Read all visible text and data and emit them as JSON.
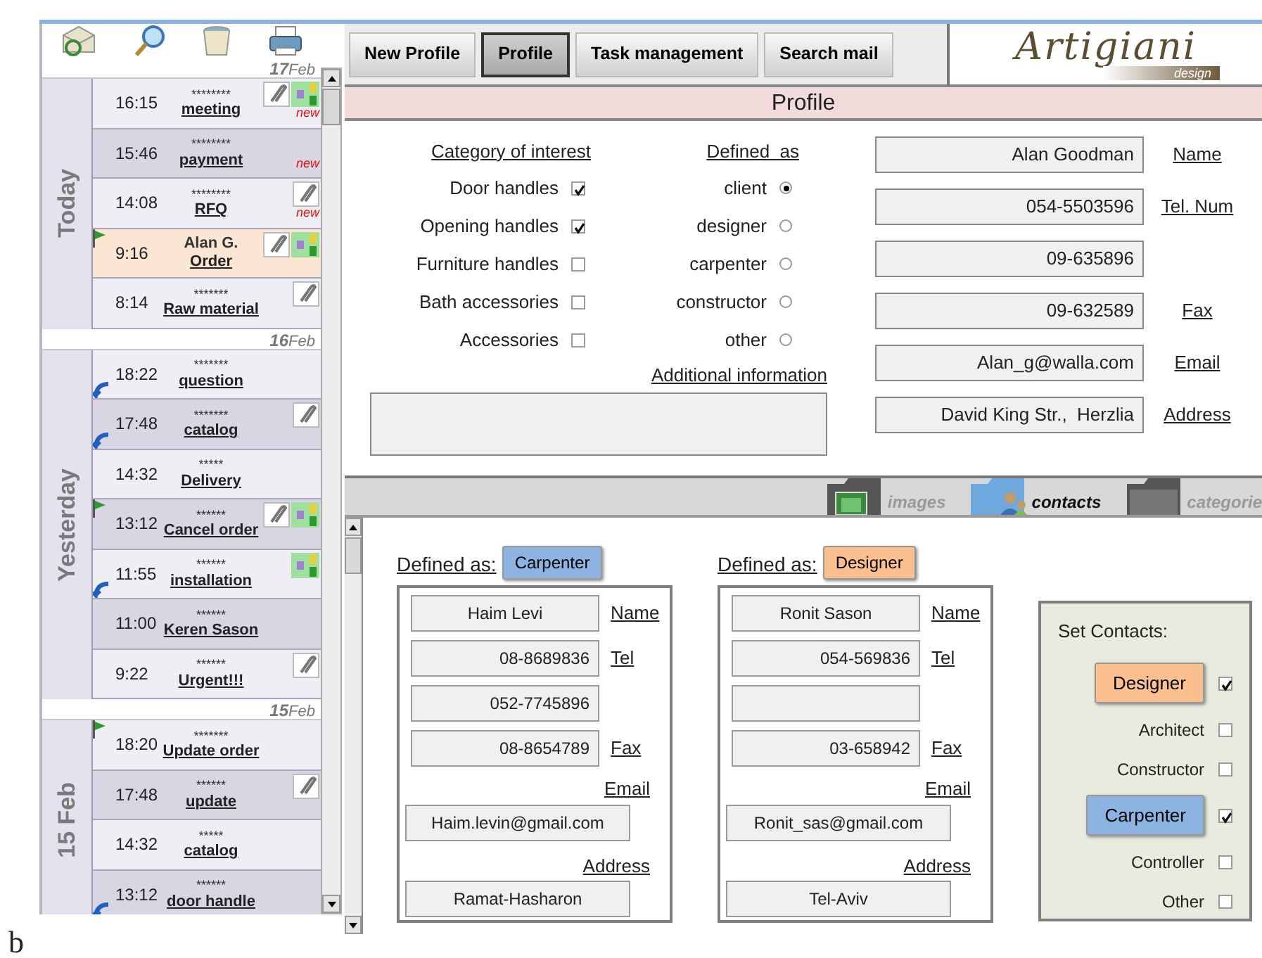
{
  "sidebar": {
    "days": [
      {
        "date_day": "17",
        "date_month": "Feb",
        "label": "Today",
        "messages": [
          {
            "time": "16:15",
            "sender": "********",
            "subject": "meeting",
            "attachment": true,
            "tags": true,
            "badge": "new",
            "flag": false,
            "reply": false,
            "selected": false
          },
          {
            "time": "15:46",
            "sender": "********",
            "subject": "payment",
            "attachment": false,
            "tags": false,
            "badge": "new",
            "flag": false,
            "reply": false,
            "selected": false
          },
          {
            "time": "14:08",
            "sender": "********",
            "subject": "RFQ",
            "attachment": true,
            "tags": false,
            "badge": "new",
            "flag": false,
            "reply": false,
            "selected": false
          },
          {
            "time": "9:16",
            "sender": "Alan G.",
            "subject": "Order",
            "attachment": true,
            "tags": true,
            "flag": true,
            "reply": false,
            "selected": true
          },
          {
            "time": "8:14",
            "sender": "*******",
            "subject": "Raw material",
            "attachment": true,
            "tags": false,
            "flag": false,
            "reply": false,
            "selected": false
          }
        ]
      },
      {
        "date_day": "16",
        "date_month": "Feb",
        "label": "Yesterday",
        "messages": [
          {
            "time": "18:22",
            "sender": "*******",
            "subject": "question",
            "attachment": false,
            "tags": false,
            "flag": false,
            "reply": true,
            "selected": false
          },
          {
            "time": "17:48",
            "sender": "*******",
            "subject": "catalog",
            "attachment": true,
            "tags": false,
            "flag": false,
            "reply": true,
            "selected": false
          },
          {
            "time": "14:32",
            "sender": "*****",
            "subject": "Delivery",
            "attachment": false,
            "tags": false,
            "flag": false,
            "reply": false,
            "selected": false
          },
          {
            "time": "13:12",
            "sender": "******",
            "subject": "Cancel order",
            "attachment": true,
            "tags": true,
            "flag": true,
            "reply": false,
            "selected": false
          },
          {
            "time": "11:55",
            "sender": "******",
            "subject": "installation",
            "attachment": false,
            "tags": true,
            "flag": false,
            "reply": true,
            "selected": false
          },
          {
            "time": "11:00",
            "sender": "******",
            "subject": "Keren Sason",
            "attachment": false,
            "tags": false,
            "flag": false,
            "reply": false,
            "selected": false
          },
          {
            "time": "9:22",
            "sender": "******",
            "subject": "Urgent!!!",
            "attachment": true,
            "tags": false,
            "flag": false,
            "reply": false,
            "selected": false
          }
        ]
      },
      {
        "date_day": "15",
        "date_month": "Feb",
        "label": "15 Feb",
        "messages": [
          {
            "time": "18:20",
            "sender": "*******",
            "subject": "Update order",
            "attachment": false,
            "tags": false,
            "flag": true,
            "reply": false,
            "selected": false
          },
          {
            "time": "17:48",
            "sender": "******",
            "subject": "update",
            "attachment": true,
            "tags": false,
            "flag": false,
            "reply": false,
            "selected": false
          },
          {
            "time": "14:32",
            "sender": "*****",
            "subject": "catalog",
            "attachment": false,
            "tags": false,
            "flag": false,
            "reply": false,
            "selected": false
          },
          {
            "time": "13:12",
            "sender": "******",
            "subject": "door handle",
            "attachment": false,
            "tags": false,
            "flag": false,
            "reply": true,
            "selected": false
          }
        ]
      }
    ]
  },
  "tabs": [
    {
      "label": "New Profile",
      "selected": false
    },
    {
      "label": "Profile",
      "selected": true
    },
    {
      "label": "Task management",
      "selected": false
    },
    {
      "label": "Search mail",
      "selected": false
    }
  ],
  "logo": {
    "name": "Artigiani",
    "tagline": "design"
  },
  "section_title": "Profile",
  "profile": {
    "category_heading": "Category of interest",
    "categories": [
      {
        "label": "Door handles",
        "checked": true
      },
      {
        "label": "Opening handles",
        "checked": true
      },
      {
        "label": "Furniture handles",
        "checked": false
      },
      {
        "label": "Bath accessories",
        "checked": false
      },
      {
        "label": "Accessories",
        "checked": false
      }
    ],
    "role_heading": "Defined  as",
    "roles": [
      {
        "label": "client",
        "selected": true
      },
      {
        "label": "designer",
        "selected": false
      },
      {
        "label": "carpenter",
        "selected": false
      },
      {
        "label": "constructor",
        "selected": false
      },
      {
        "label": "other",
        "selected": false
      }
    ],
    "additional_info_label": "Additional information",
    "fields": [
      {
        "value": "Alan Goodman",
        "label": "Name"
      },
      {
        "value": "054-5503596",
        "label": "Tel. Num"
      },
      {
        "value": "09-635896"
      },
      {
        "value": "09-632589",
        "label": "Fax"
      },
      {
        "value": "Alan_g@walla.com",
        "label": "Email"
      },
      {
        "value": "David King Str.,  Herzlia",
        "label": "Address"
      }
    ]
  },
  "folders": [
    {
      "label": "images",
      "selected": false
    },
    {
      "label": "contacts",
      "selected": true
    },
    {
      "label": "categorie",
      "selected": false
    }
  ],
  "contacts": [
    {
      "defined_as": "Defined as:",
      "role": "Carpenter",
      "color": "#8db3e2",
      "fields": [
        {
          "kind": "name",
          "value": "Haim Levi",
          "label": "Name"
        },
        {
          "kind": "phone",
          "value": "08-8689836",
          "label": "Tel"
        },
        {
          "kind": "phone",
          "value": "052-7745896"
        },
        {
          "kind": "phone",
          "value": "08-8654789",
          "label": "Fax"
        },
        {
          "kind": "stacked",
          "value": "Haim.levin@gmail.com",
          "label": "Email"
        },
        {
          "kind": "stacked",
          "value": "Ramat-Hasharon",
          "label": "Address"
        }
      ]
    },
    {
      "defined_as": "Defined as:",
      "role": "Designer",
      "color": "#fac08f",
      "fields": [
        {
          "kind": "name",
          "value": "Ronit Sason",
          "label": "Name"
        },
        {
          "kind": "phone",
          "value": "054-569836",
          "label": "Tel"
        },
        {
          "kind": "phone"
        },
        {
          "kind": "phone",
          "value": "03-658942",
          "label": "Fax"
        },
        {
          "kind": "stacked",
          "value": "Ronit_sas@gmail.com",
          "label": "Email"
        },
        {
          "kind": "stacked",
          "value": "Tel-Aviv",
          "label": "Address"
        }
      ]
    }
  ],
  "set_contacts": {
    "title": "Set Contacts:",
    "options": [
      {
        "kind": "button",
        "label": "Designer",
        "color": "#fac08f",
        "checked": true
      },
      {
        "kind": "plain",
        "label": "Architect",
        "checked": false
      },
      {
        "kind": "plain",
        "label": "Constructor",
        "checked": false
      },
      {
        "kind": "button",
        "label": "Carpenter",
        "color": "#8db3e2",
        "checked": true
      },
      {
        "kind": "plain",
        "label": "Controller",
        "checked": false
      },
      {
        "kind": "plain",
        "label": "Other",
        "checked": false
      }
    ]
  },
  "figure_label": "b"
}
